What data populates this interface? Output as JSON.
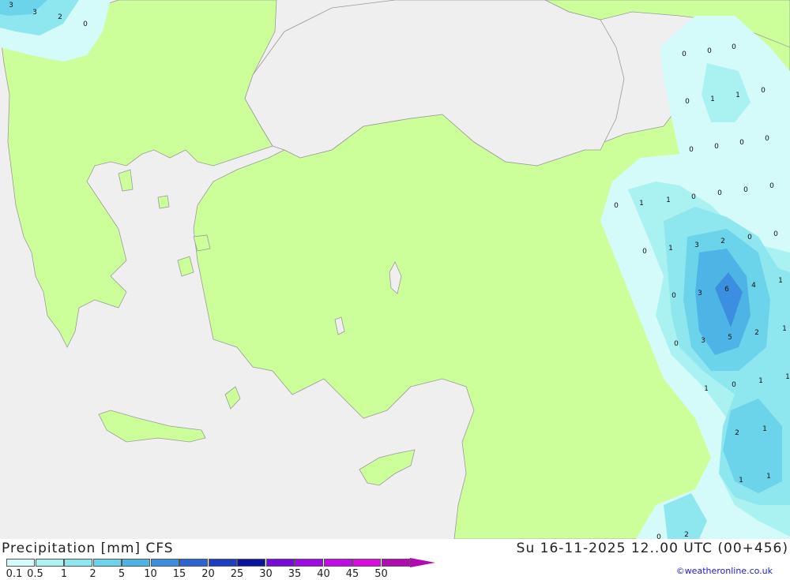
{
  "header": {
    "title": "Precipitation [mm] CFS",
    "datetime": "Su 16-11-2025 12..00 UTC (00+456)",
    "credit": "©weatheronline.co.uk"
  },
  "legend": {
    "items": [
      {
        "label": "0.1",
        "color": "#d4fafa"
      },
      {
        "label": "0.5",
        "color": "#aaf2f2"
      },
      {
        "label": "1",
        "color": "#8ee6ee"
      },
      {
        "label": "2",
        "color": "#6cd4ea"
      },
      {
        "label": "5",
        "color": "#4eb4e6"
      },
      {
        "label": "10",
        "color": "#3c8ee0"
      },
      {
        "label": "15",
        "color": "#2c64d6"
      },
      {
        "label": "20",
        "color": "#1c3ec4"
      },
      {
        "label": "25",
        "color": "#0a14a0"
      },
      {
        "label": "30",
        "color": "#7a0adc"
      },
      {
        "label": "35",
        "color": "#a00ae6"
      },
      {
        "label": "40",
        "color": "#c40aea"
      },
      {
        "label": "45",
        "color": "#dc0ae0"
      },
      {
        "label": "50",
        "color": "#b40ab4"
      }
    ]
  },
  "map": {
    "land_color": "#ccff99",
    "sea_color": "#efefef",
    "values": [
      {
        "v": "3"
      },
      {
        "v": "3"
      },
      {
        "v": "2"
      },
      {
        "v": "0"
      },
      {
        "v": "0"
      },
      {
        "v": "0"
      },
      {
        "v": "0"
      },
      {
        "v": "0"
      },
      {
        "v": "1"
      },
      {
        "v": "1"
      },
      {
        "v": "0"
      },
      {
        "v": "0"
      },
      {
        "v": "0"
      },
      {
        "v": "0"
      },
      {
        "v": "0"
      },
      {
        "v": "0"
      },
      {
        "v": "1"
      },
      {
        "v": "1"
      },
      {
        "v": "0"
      },
      {
        "v": "0"
      },
      {
        "v": "0"
      },
      {
        "v": "0"
      },
      {
        "v": "0"
      },
      {
        "v": "1"
      },
      {
        "v": "3"
      },
      {
        "v": "2"
      },
      {
        "v": "0"
      },
      {
        "v": "0"
      },
      {
        "v": "0"
      },
      {
        "v": "3"
      },
      {
        "v": "6"
      },
      {
        "v": "4"
      },
      {
        "v": "1"
      },
      {
        "v": "0"
      },
      {
        "v": "3"
      },
      {
        "v": "5"
      },
      {
        "v": "2"
      },
      {
        "v": "1"
      },
      {
        "v": "1"
      },
      {
        "v": "0"
      },
      {
        "v": "1"
      },
      {
        "v": "1"
      },
      {
        "v": "2"
      },
      {
        "v": "1"
      },
      {
        "v": "1"
      },
      {
        "v": "1"
      },
      {
        "v": "0"
      },
      {
        "v": "2"
      }
    ]
  }
}
